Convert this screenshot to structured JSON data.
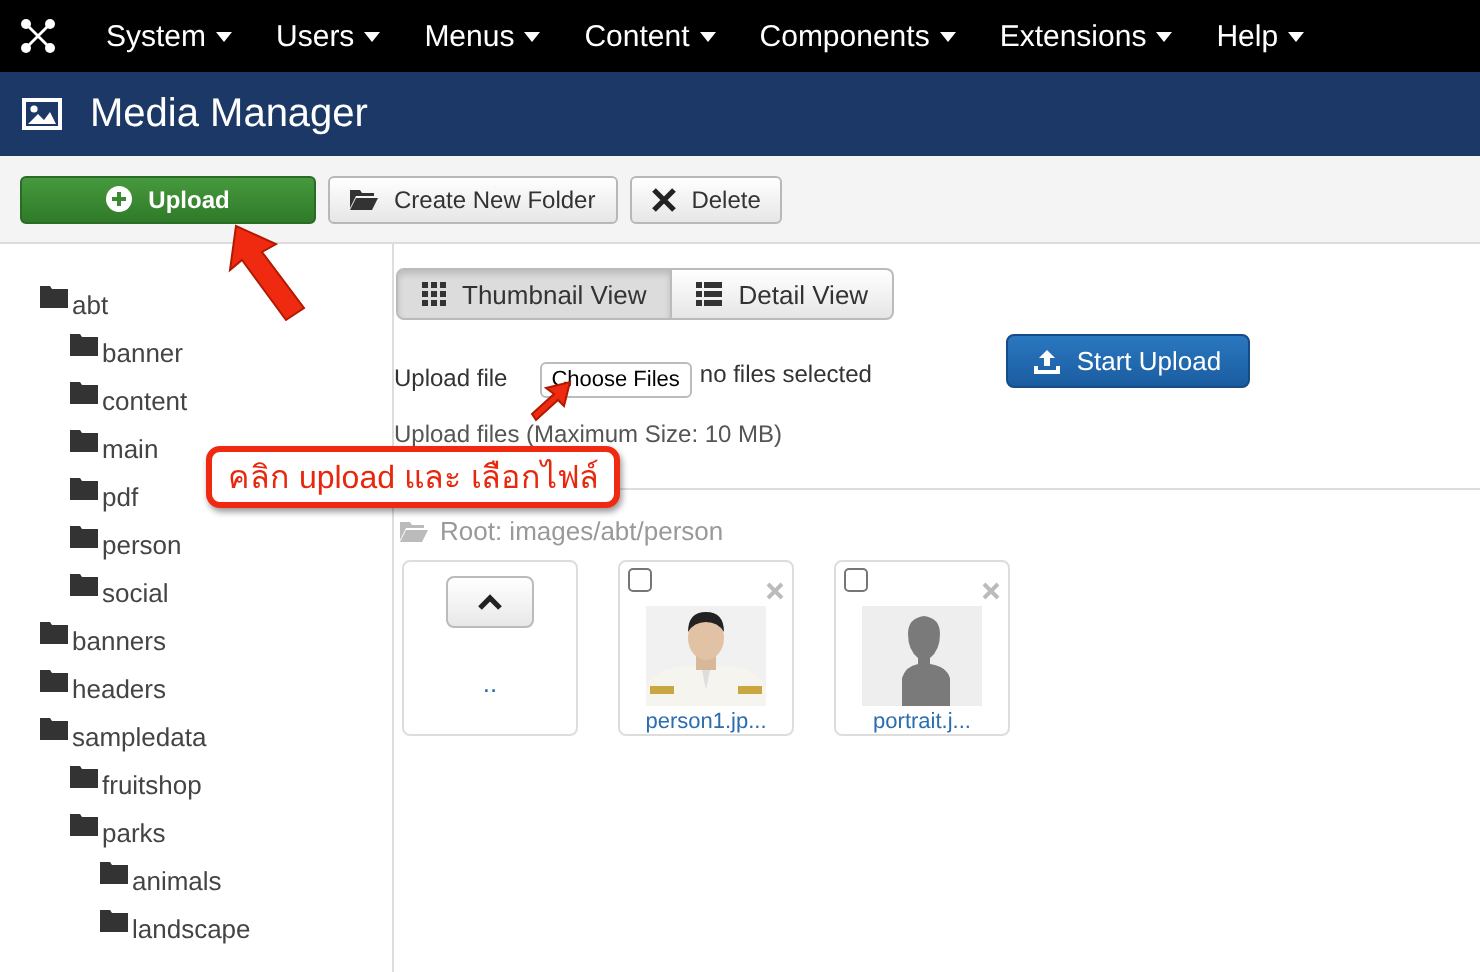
{
  "navbar": {
    "menus": [
      {
        "label": "System"
      },
      {
        "label": "Users"
      },
      {
        "label": "Menus"
      },
      {
        "label": "Content"
      },
      {
        "label": "Components"
      },
      {
        "label": "Extensions"
      },
      {
        "label": "Help"
      }
    ]
  },
  "header": {
    "title": "Media Manager"
  },
  "toolbar": {
    "buttons": [
      {
        "label": "Upload",
        "kind": "upload"
      },
      {
        "label": "Create New Folder",
        "kind": "folder"
      },
      {
        "label": "Delete",
        "kind": "delete"
      }
    ]
  },
  "folders": [
    {
      "name": "abt",
      "children": [
        {
          "name": "banner"
        },
        {
          "name": "content"
        },
        {
          "name": "main"
        },
        {
          "name": "pdf"
        },
        {
          "name": "person"
        },
        {
          "name": "social"
        }
      ]
    },
    {
      "name": "banners"
    },
    {
      "name": "headers"
    },
    {
      "name": "sampledata",
      "children": [
        {
          "name": "fruitshop"
        },
        {
          "name": "parks",
          "children": [
            {
              "name": "animals"
            },
            {
              "name": "landscape"
            }
          ]
        }
      ]
    }
  ],
  "view_switch": [
    {
      "label": "Thumbnail View",
      "kind": "grid",
      "selected": true
    },
    {
      "label": "Detail View",
      "kind": "list",
      "selected": false
    }
  ],
  "upload": {
    "label": "Upload file",
    "button": "Choose Files",
    "status": "no files selected",
    "submit": "Start Upload",
    "note": "Upload files (Maximum Size: 10 MB)"
  },
  "breadcrumb": "Root: images/abt/person",
  "items": [
    {
      "kind": "up",
      "label": ".."
    },
    {
      "name": "person1.jp...",
      "checked": false
    },
    {
      "kind": "silhouette",
      "name": "portrait.j...",
      "checked": false
    }
  ],
  "annotation": {
    "text": "คลิก upload และ เลือกไฟล์"
  }
}
